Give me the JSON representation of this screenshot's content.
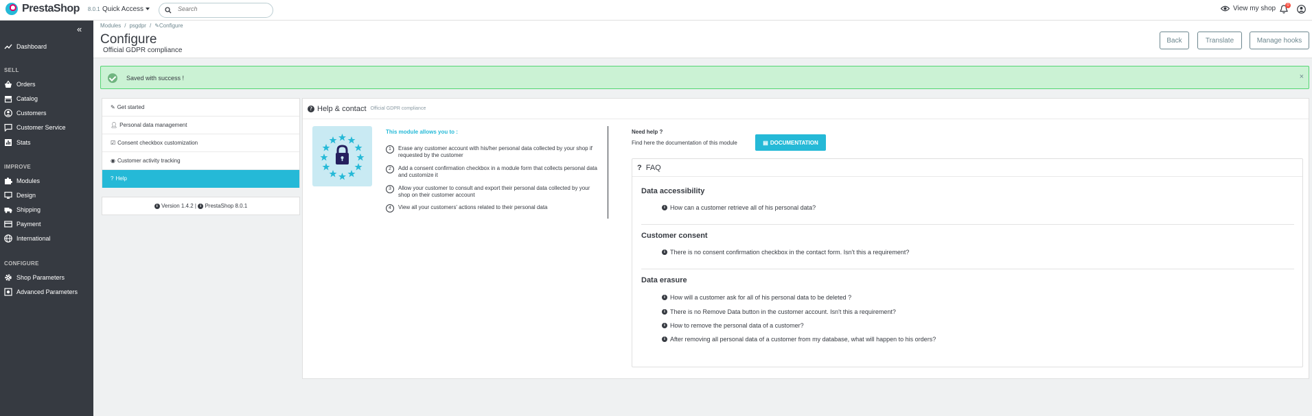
{
  "topbar": {
    "logo_text": "PrestaShop",
    "version": "8.0.1",
    "quick_access": "Quick Access",
    "search_placeholder": "Search",
    "view_shop": "View my shop",
    "notifications_count": "0"
  },
  "sidebar": {
    "dashboard": "Dashboard",
    "sections": {
      "sell": "SELL",
      "improve": "IMPROVE",
      "configure": "CONFIGURE"
    },
    "items": {
      "orders": "Orders",
      "catalog": "Catalog",
      "customers": "Customers",
      "customer_service": "Customer Service",
      "stats": "Stats",
      "modules": "Modules",
      "design": "Design",
      "shipping": "Shipping",
      "payment": "Payment",
      "international": "International",
      "shop_parameters": "Shop Parameters",
      "advanced_parameters": "Advanced Parameters"
    }
  },
  "header": {
    "breadcrumb": [
      "Modules",
      "/",
      "psgdpr",
      "/",
      "Configure"
    ],
    "title": "Configure",
    "subtitle": "Official GDPR compliance",
    "buttons": {
      "back": "Back",
      "translate": "Translate",
      "manage_hooks": "Manage hooks"
    }
  },
  "alert": {
    "message": "Saved with success !",
    "close": "×"
  },
  "module_menu": {
    "items": [
      "Get started",
      "Personal data management",
      "Consent checkbox customization",
      "Customer activity tracking",
      "Help"
    ],
    "active_index": 4,
    "version_text": "Version 1.4.2 | ",
    "ps_version_text": "PrestaShop 8.0.1"
  },
  "panel": {
    "title": "Help & contact",
    "title_sub": "Official GDPR compliance",
    "allows_title": "This module allows you to :",
    "steps": [
      {
        "num": "1",
        "text": "Erase any customer account with his/her personal data collected by your shop if requested by the customer"
      },
      {
        "num": "2",
        "text": "Add a consent confirmation checkbox in a module form that collects personal data and customize it"
      },
      {
        "num": "3",
        "text": "Allow your customer to consult and export their personal data collected by your shop on their customer account"
      },
      {
        "num": "4",
        "text": "View all your customers' actions related to their personal data"
      }
    ],
    "need_help": "Need help ?",
    "find_doc": "Find here the documentation of this module",
    "doc_button": "DOCUMENTATION"
  },
  "faq": {
    "title": "FAQ",
    "categories": [
      {
        "name": "Data accessibility",
        "questions": [
          "How can a customer retrieve all of his personal data?"
        ]
      },
      {
        "name": "Customer consent",
        "questions": [
          "There is no consent confirmation checkbox in the contact form. Isn't this a requirement?"
        ]
      },
      {
        "name": "Data erasure",
        "questions": [
          "How will a customer ask for all of his personal data to be deleted ?",
          "There is no Remove Data button in the customer account. Isn't this a requirement?",
          "How to remove the personal data of a customer?",
          "After removing all personal data of a customer from my database, what will happen to his orders?"
        ]
      }
    ]
  },
  "colors": {
    "accent": "#25b9d7",
    "sidebar_bg": "#363a41",
    "success_bg": "#cbf2d4",
    "success_border": "#53d572"
  }
}
